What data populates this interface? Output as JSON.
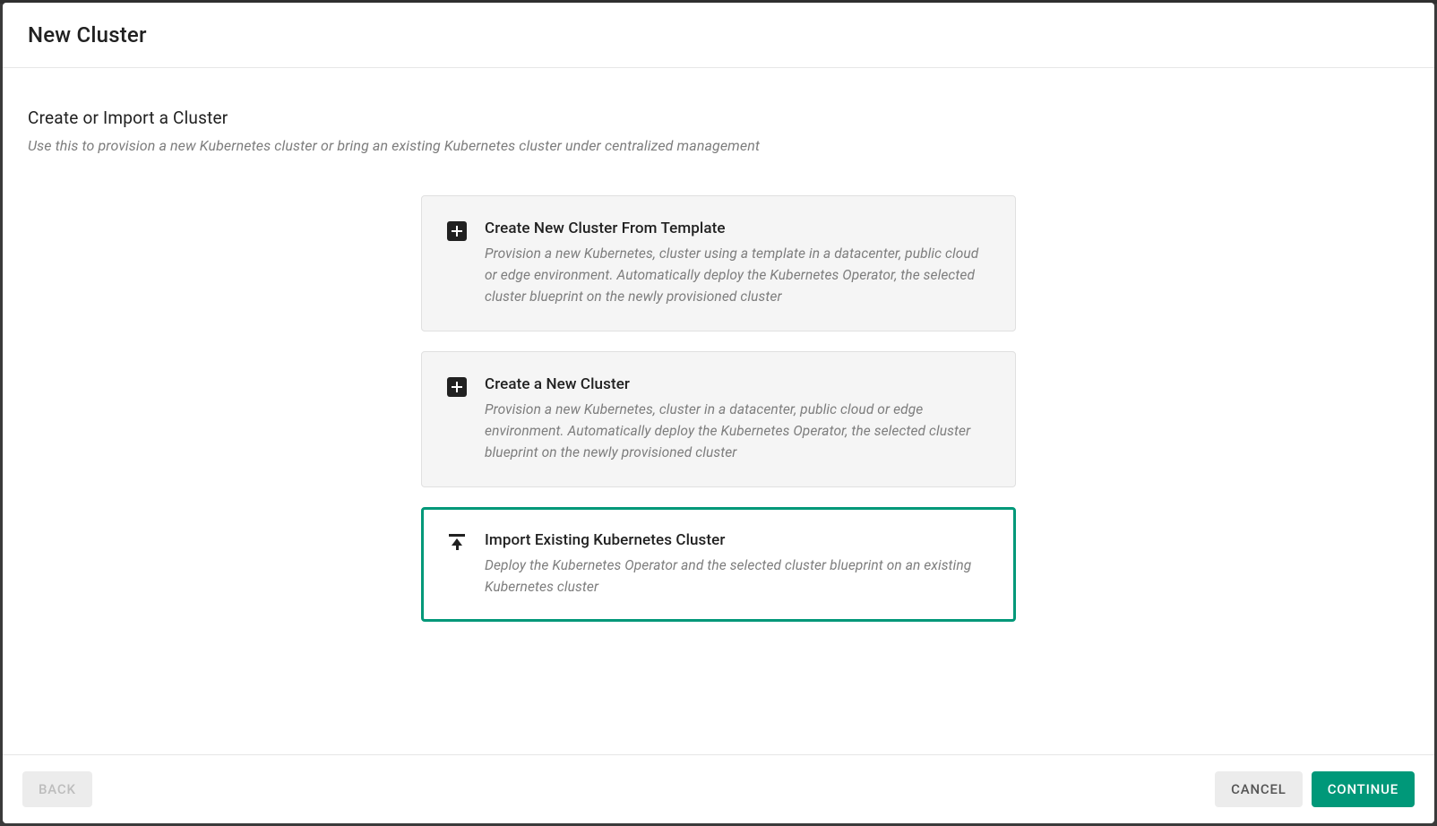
{
  "header": {
    "title": "New Cluster"
  },
  "section": {
    "title": "Create or Import a Cluster",
    "subtitle": "Use this to provision a new Kubernetes cluster or bring an existing Kubernetes cluster under centralized management"
  },
  "options": [
    {
      "title": "Create New Cluster From Template",
      "desc": "Provision a new Kubernetes, cluster using a template in a datacenter, public cloud or edge environment. Automatically deploy the Kubernetes Operator, the selected cluster blueprint on the newly provisioned cluster"
    },
    {
      "title": "Create a New Cluster",
      "desc": "Provision a new Kubernetes, cluster in a datacenter, public cloud or edge environment. Automatically deploy the Kubernetes Operator, the selected cluster blueprint on the newly provisioned cluster"
    },
    {
      "title": "Import Existing Kubernetes Cluster",
      "desc": "Deploy the Kubernetes Operator and the selected cluster blueprint on an existing Kubernetes cluster"
    }
  ],
  "footer": {
    "back": "BACK",
    "cancel": "CANCEL",
    "continue": "CONTINUE"
  }
}
